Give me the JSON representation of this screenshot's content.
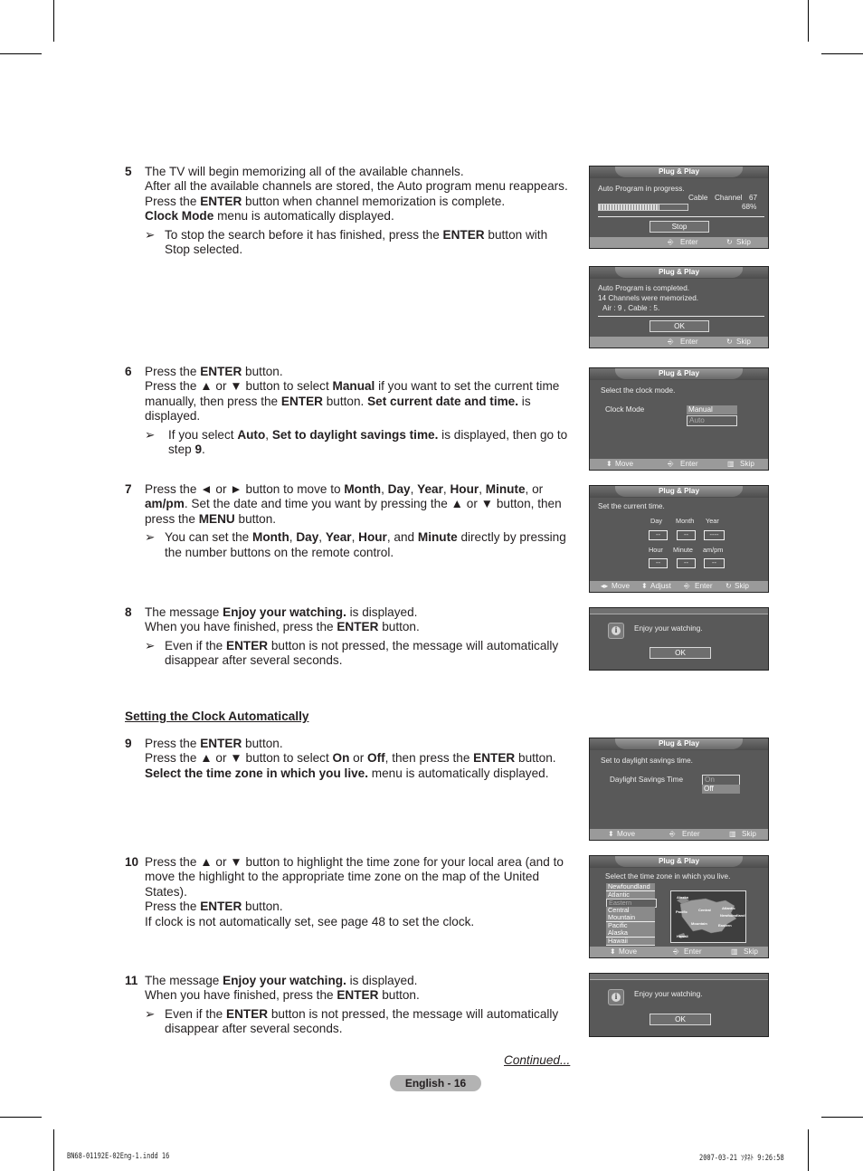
{
  "page": {
    "continued": "Continued...",
    "page_label": "English - 16",
    "slug_left": "BN68-01192E-02Eng-1.indd   16",
    "slug_right": "2007-03-21   ｿﾀﾈﾄ 9:26:58"
  },
  "steps": {
    "s5": {
      "num": "5",
      "l1": "The TV will begin memorizing all of the available channels.",
      "l2": "After all the available channels are stored, the Auto program menu reappears.",
      "l3a": "Press the ",
      "l3b": "ENTER",
      "l3c": " button when channel memorization is complete.",
      "l4a": "Clock Mode",
      "l4b": " menu is automatically displayed.",
      "note_a": "To stop the search before it has finished, press the ",
      "note_b": "ENTER",
      "note_c": " button with Stop selected."
    },
    "s6": {
      "num": "6",
      "l1a": "Press the ",
      "l1b": "ENTER",
      "l1c": " button.",
      "l2a": "Press the ▲ or ▼ button to select ",
      "l2b": "Manual",
      "l2c": " if you want to set the current time manually, then press the ",
      "l2d": "ENTER",
      "l2e": " button. ",
      "l2f": "Set current date and time.",
      "l2g": " is displayed.",
      "note_a": "If you select ",
      "note_b": "Auto",
      "note_c": ", ",
      "note_d": "Set to daylight savings time.",
      "note_e": " is displayed, then go to step ",
      "note_f": "9",
      "note_g": "."
    },
    "s7": {
      "num": "7",
      "l1a": "Press the ◄ or ► button to move to ",
      "m": "Month",
      "d": "Day",
      "y": "Year",
      "h": "Hour",
      "mi": "Minute",
      "ap": "am/pm",
      "l1b": ". Set the date and time you want by pressing the ▲ or ▼ button, then press the ",
      "menu": "MENU",
      "l1c": " button.",
      "note_a": "You can set the ",
      "note_b": " directly by pressing the number buttons on the remote control.",
      "and": "and"
    },
    "s8": {
      "num": "8",
      "l1a": "The message ",
      "l1b": "Enjoy your watching.",
      "l1c": " is displayed.",
      "l2a": "When you have finished, press the ",
      "l2b": "ENTER",
      "l2c": " button.",
      "note_a": "Even if the ",
      "note_b": "ENTER",
      "note_c": " button is not pressed, the message will automatically disappear after several seconds."
    },
    "heading": "Setting the Clock Automatically",
    "s9": {
      "num": "9",
      "l1a": "Press the ",
      "l1b": "ENTER",
      "l1c": " button.",
      "l2a": "Press the ▲ or ▼ button to select ",
      "on": "On",
      "or": " or ",
      "off": "Off",
      "l2b": ", then press the ",
      "l2c": "ENTER",
      "l2d": " button.",
      "l3a": "Select the time zone in which you live.",
      "l3b": " menu is automatically displayed."
    },
    "s10": {
      "num": "10",
      "l1": "Press the ▲ or ▼ button to highlight the time zone for your local area (and to move the highlight to the appropriate time zone on the map of the United States).",
      "l2a": "Press the ",
      "l2b": "ENTER",
      "l2c": " button.",
      "l3": "If clock is not automatically set, see page 48 to set the clock."
    },
    "s11": {
      "num": "11",
      "l1a": "The message ",
      "l1b": "Enjoy your watching.",
      "l1c": " is displayed.",
      "l2a": "When you have finished, press the ",
      "l2b": "ENTER",
      "l2c": " button.",
      "note_a": "Even if the ",
      "note_b": "ENTER",
      "note_c": " button is not pressed, the message will automatically disappear after several seconds."
    }
  },
  "osd": {
    "title": "Plug & Play",
    "enter": "Enter",
    "skip": "Skip",
    "move": "Move",
    "adjust": "Adjust",
    "progress": {
      "message": "Auto Program in progress.",
      "source": "Cable",
      "channel_label": "Channel",
      "channel": "67",
      "percent_text": "68%",
      "percent": 68,
      "stop": "Stop"
    },
    "completed": {
      "l1": "Auto Program is completed.",
      "l2": "14 Channels were memorized.",
      "l3": "Air   : 9 , Cable  : 5.",
      "ok": "OK"
    },
    "clock_mode": {
      "prompt": "Select the clock mode.",
      "label": "Clock Mode",
      "options": [
        "Manual",
        "Auto"
      ],
      "selected": "Manual"
    },
    "set_time": {
      "prompt": "Set the current time.",
      "labels_top": [
        "Day",
        "Month",
        "Year"
      ],
      "values_top": [
        "--",
        "--",
        "----"
      ],
      "labels_bottom": [
        "Hour",
        "Minute",
        "am/pm"
      ],
      "values_bottom": [
        "--",
        "--",
        "--"
      ]
    },
    "enjoy": {
      "message": "Enjoy your watching.",
      "ok": "OK"
    },
    "dst": {
      "prompt": "Set to daylight savings time.",
      "label": "Daylight Savings Time",
      "options": [
        "On",
        "Off"
      ],
      "selected": "On"
    },
    "timezone": {
      "prompt": "Select the time zone in which you live.",
      "zones": [
        "Newfoundland",
        "Atlantic",
        "Eastern",
        "Central",
        "Mountain",
        "Pacific",
        "Alaska",
        "Hawaii"
      ],
      "selected": "Eastern",
      "map_labels": [
        "Alaska",
        "Pacific",
        "Central",
        "Atlantic",
        "Newfoundland",
        "Mountain",
        "Eastern",
        "Hawaii"
      ]
    }
  }
}
